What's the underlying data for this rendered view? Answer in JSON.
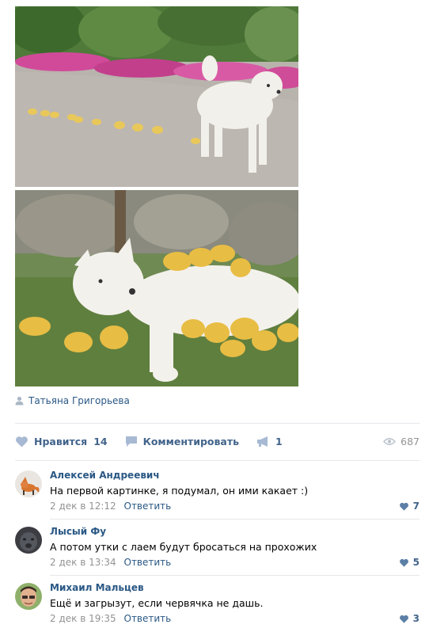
{
  "post": {
    "author": "Татьяна Григорьева",
    "likes_label": "Нравится",
    "likes_count": "14",
    "comment_label": "Комментировать",
    "share_count": "1",
    "views_count": "687"
  },
  "comments": [
    {
      "name": "Алексей Андреевич",
      "text": "На первой картинке, я подумал, он ими какает :)",
      "date": "2 дек в 12:12",
      "reply": "Ответить",
      "likes": "7"
    },
    {
      "name": "Лысый Фу",
      "text": "А потом утки с лаем будут бросаться на прохожих",
      "date": "2 дек в 13:34",
      "reply": "Ответить",
      "likes": "5"
    },
    {
      "name": "Михаил Мальцев",
      "text": "Ещё и загрызут, если червячка не дашь.",
      "date": "2 дек в 19:35",
      "reply": "Ответить",
      "likes": "3"
    }
  ],
  "colors": {
    "link": "#2a5885",
    "action": "#42648b",
    "muted": "#939393",
    "divider": "#e7e8ec"
  },
  "icons": {
    "author": "person-icon",
    "like": "heart-icon",
    "comment": "speech-bubble-icon",
    "share": "megaphone-icon",
    "views": "eye-icon"
  }
}
